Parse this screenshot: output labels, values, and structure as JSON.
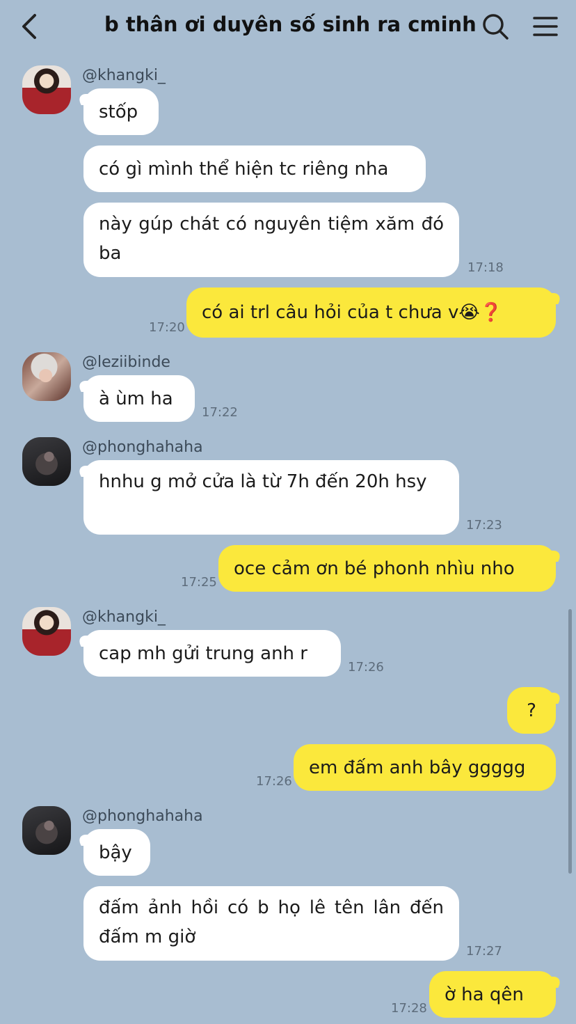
{
  "header": {
    "title": "b thân ơi duyên số sinh ra cminh",
    "back_icon": "chevron-left-icon",
    "search_icon": "search-icon",
    "menu_icon": "hamburger-menu-icon"
  },
  "messages": [
    {
      "user": "@khangki_",
      "text": "stốp"
    },
    {
      "text": "có gì mình thể hiện tc riêng nha"
    },
    {
      "text": "này gúp chát có nguyên tiệm xăm đó ba",
      "time": "17:18"
    },
    {
      "text": "có ai trl câu hỏi của t chưa v😭❓",
      "time": "17:20"
    },
    {
      "user": "@leziibinde",
      "text": "à ùm ha",
      "time": "17:22"
    },
    {
      "user": "@phonghahaha",
      "text": "hnhu g mở cửa là từ 7h đến 20h hsy",
      "time": "17:23"
    },
    {
      "text": "oce cảm ơn bé phonh nhìu nho",
      "time": "17:25"
    },
    {
      "user": "@khangki_",
      "text": "cap mh gửi trung anh r",
      "time": "17:26"
    },
    {
      "text": "?"
    },
    {
      "text": "em đấm anh bây ggggg",
      "time": "17:26"
    },
    {
      "user": "@phonghahaha",
      "text": "bậy"
    },
    {
      "text": "đấm ảnh hồi có b họ lê tên lân đến đấm m giờ",
      "time": "17:27"
    },
    {
      "text": "ờ ha qên",
      "time": "17:28"
    }
  ],
  "colors": {
    "background": "#a8bdd1",
    "incoming_bubble": "#ffffff",
    "outgoing_bubble": "#fbe83c"
  }
}
